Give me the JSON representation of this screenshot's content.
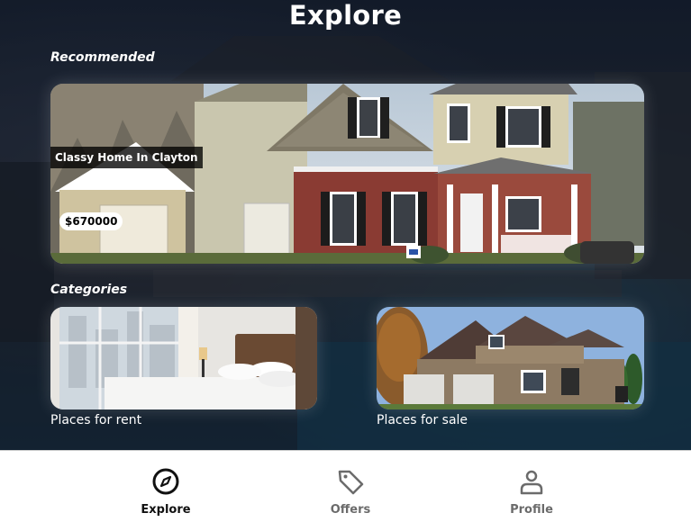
{
  "header": {
    "title": "Explore"
  },
  "sections": {
    "recommended_label": "Recommended",
    "categories_label": "Categories"
  },
  "recommended": {
    "name": "Classy Home In Clayton",
    "price": "$670000"
  },
  "categories": [
    {
      "label": "Places for rent"
    },
    {
      "label": "Places for sale"
    }
  ],
  "tabbar": {
    "tabs": [
      {
        "label": "Explore",
        "icon": "compass-icon",
        "active": true
      },
      {
        "label": "Offers",
        "icon": "tag-icon",
        "active": false
      },
      {
        "label": "Profile",
        "icon": "person-icon",
        "active": false
      }
    ]
  },
  "colors": {
    "active_tab": "#111111",
    "inactive_tab": "#6b6b6b",
    "tabbar_bg": "#ffffff"
  }
}
